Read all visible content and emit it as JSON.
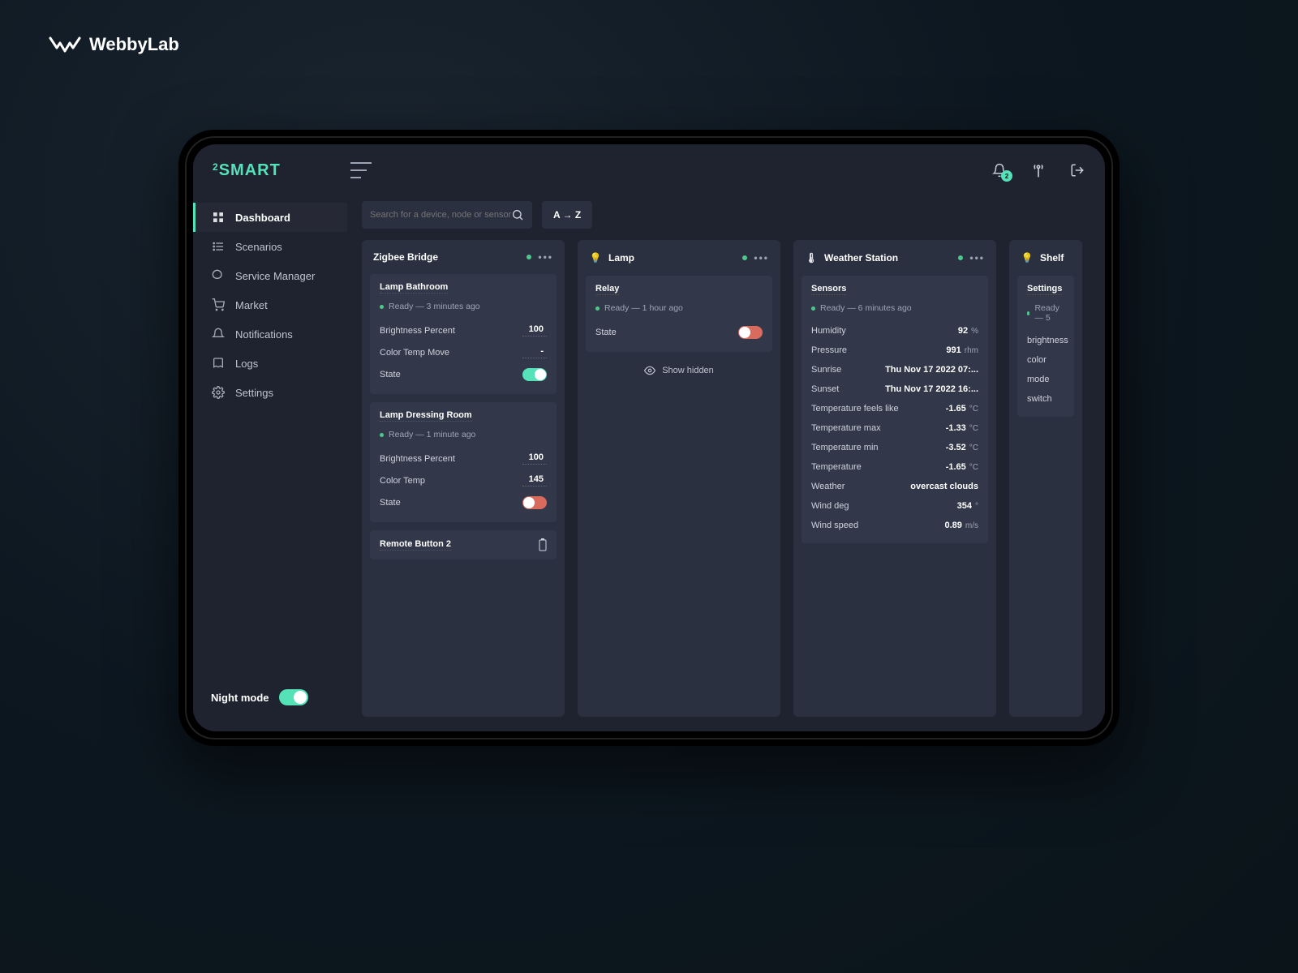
{
  "brand": "WebbyLab",
  "app_logo_prefix": "2",
  "app_logo": "SMART",
  "notification_count": "2",
  "search": {
    "placeholder": "Search for a device, node or sensor"
  },
  "sort_label": "A → Z",
  "sidebar": {
    "items": [
      {
        "label": "Dashboard",
        "active": true
      },
      {
        "label": "Scenarios"
      },
      {
        "label": "Service Manager"
      },
      {
        "label": "Market"
      },
      {
        "label": "Notifications"
      },
      {
        "label": "Logs"
      },
      {
        "label": "Settings"
      }
    ],
    "night_label": "Night mode"
  },
  "cards": {
    "zigbee": {
      "title": "Zigbee Bridge",
      "lamp1": {
        "title": "Lamp Bathroom",
        "status": "Ready — 3 minutes ago",
        "rows": [
          {
            "k": "Brightness Percent",
            "v": "100"
          },
          {
            "k": "Color Temp Move",
            "v": "-"
          },
          {
            "k": "State",
            "toggle": "on"
          }
        ]
      },
      "lamp2": {
        "title": "Lamp Dressing Room",
        "status": "Ready — 1 minute ago",
        "rows": [
          {
            "k": "Brightness Percent",
            "v": "100"
          },
          {
            "k": "Color Temp",
            "v": "145"
          },
          {
            "k": "State",
            "toggle": "off"
          }
        ]
      },
      "remote": {
        "title": "Remote Button 2"
      }
    },
    "lamp": {
      "title": "Lamp",
      "relay": {
        "title": "Relay",
        "status": "Ready — 1 hour ago",
        "rows": [
          {
            "k": "State",
            "toggle": "off"
          }
        ]
      },
      "show_hidden": "Show hidden"
    },
    "weather": {
      "title": "Weather Station",
      "sensors": {
        "title": "Sensors",
        "status": "Ready — 6 minutes ago",
        "rows": [
          {
            "k": "Humidity",
            "v": "92",
            "u": "%"
          },
          {
            "k": "Pressure",
            "v": "991",
            "u": "rhm"
          },
          {
            "k": "Sunrise",
            "v": "Thu Nov 17 2022 07:..."
          },
          {
            "k": "Sunset",
            "v": "Thu Nov 17 2022 16:..."
          },
          {
            "k": "Temperature feels like",
            "v": "-1.65",
            "u": "°C"
          },
          {
            "k": "Temperature max",
            "v": "-1.33",
            "u": "°C"
          },
          {
            "k": "Temperature min",
            "v": "-3.52",
            "u": "°C"
          },
          {
            "k": "Temperature",
            "v": "-1.65",
            "u": "°C"
          },
          {
            "k": "Weather",
            "v": "overcast clouds"
          },
          {
            "k": "Wind deg",
            "v": "354",
            "u": "°"
          },
          {
            "k": "Wind speed",
            "v": "0.89",
            "u": "m/s"
          }
        ]
      }
    },
    "shelf": {
      "title": "Shelf",
      "settings": {
        "title": "Settings",
        "status": "Ready — 5",
        "rows": [
          {
            "k": "brightness"
          },
          {
            "k": "color"
          },
          {
            "k": "mode"
          },
          {
            "k": "switch"
          }
        ]
      }
    }
  }
}
